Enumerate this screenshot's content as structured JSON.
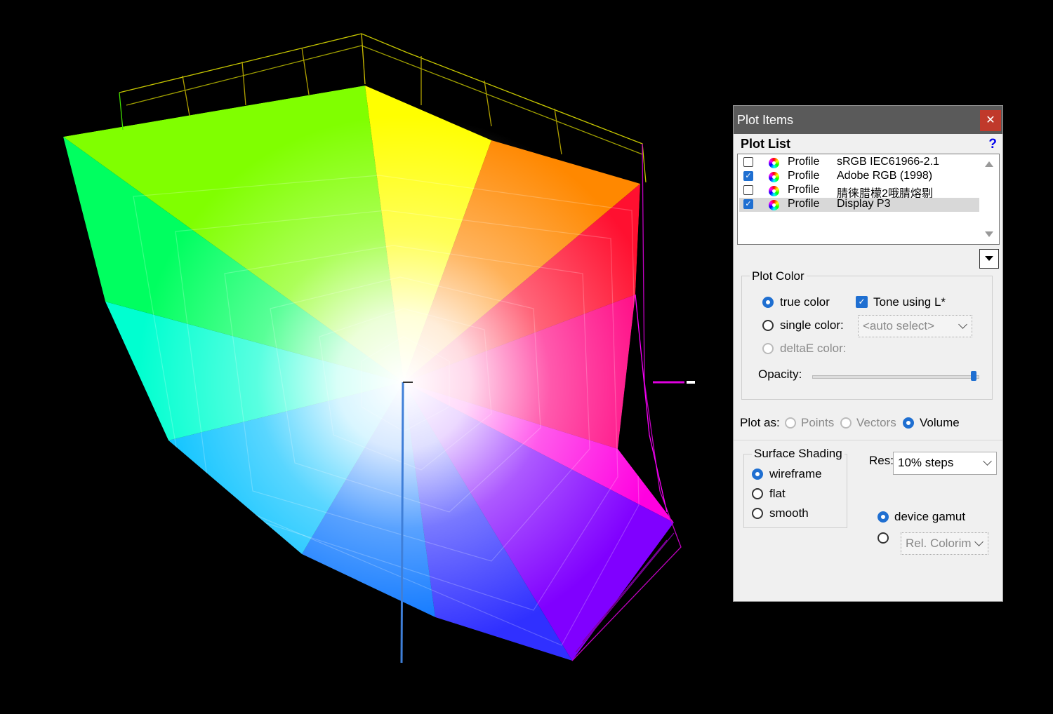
{
  "panel": {
    "title": "Plot Items",
    "close_label": "✕",
    "plot_list_label": "Plot List",
    "help_label": "?",
    "items": [
      {
        "type": "Profile",
        "name": "sRGB IEC61966-2.1",
        "checked": false,
        "selected": false
      },
      {
        "type": "Profile",
        "name": "Adobe RGB (1998)",
        "checked": true,
        "selected": false
      },
      {
        "type": "Profile",
        "name": "腈徕腊檬2哦腈熔剔",
        "checked": false,
        "selected": false
      },
      {
        "type": "Profile",
        "name": "Display P3",
        "checked": true,
        "selected": true
      }
    ],
    "plot_color": {
      "label": "Plot Color",
      "true_color": "true color",
      "single_color": "single color:",
      "deltae_color": "deltaE color:",
      "tone_label": "Tone using L*",
      "auto_select": "<auto select>",
      "opacity_label": "Opacity:",
      "opacity": 0.96
    },
    "plot_as": {
      "label": "Plot as:",
      "points": "Points",
      "vectors": "Vectors",
      "volume": "Volume"
    },
    "surface_shading": {
      "label": "Surface Shading",
      "wireframe": "wireframe",
      "flat": "flat",
      "smooth": "smooth"
    },
    "res_label": "Res:",
    "res_value": "10% steps",
    "device_gamut": "device gamut",
    "rel_colorim": "Rel. Colorim"
  },
  "colors": {
    "accent": "#1f6fd1",
    "close": "#c0392b",
    "title_bar": "#5a5a5a"
  }
}
